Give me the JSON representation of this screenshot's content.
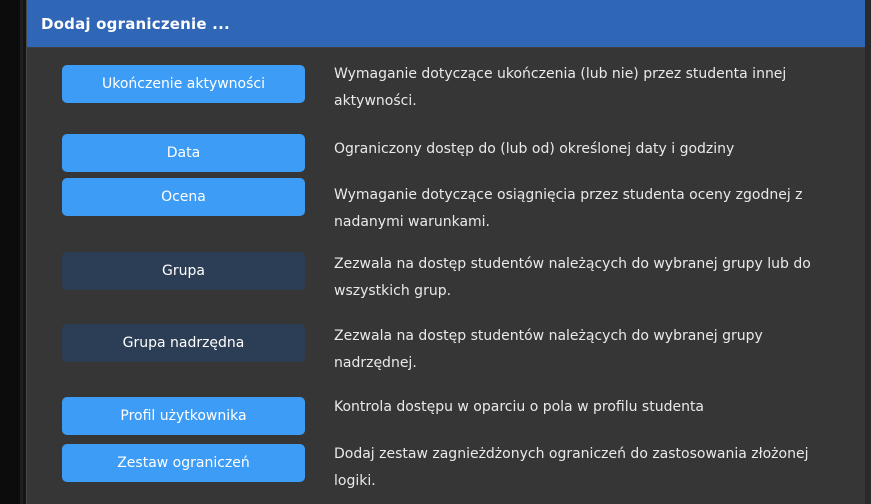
{
  "dialog": {
    "title": "Dodaj ograniczenie ..."
  },
  "options": [
    {
      "label": "Ukończenie aktywności",
      "description": "Wymaganie dotyczące ukończenia (lub nie) przez studenta innej aktywności."
    },
    {
      "label": "Data",
      "description": "Ograniczony dostęp do (lub od) określonej daty i godziny"
    },
    {
      "label": "Ocena",
      "description": "Wymaganie dotyczące osiągnięcia przez studenta oceny zgodnej z nadanymi warunkami."
    },
    {
      "label": "Grupa",
      "description": "Zezwala na dostęp studentów należących do wybranej grupy lub do wszystkich grup."
    },
    {
      "label": "Grupa nadrzędna",
      "description": "Zezwala na dostęp studentów należących do wybranej grupy nadrzędnej."
    },
    {
      "label": "Profil użytkownika",
      "description": "Kontrola dostępu w oparciu o pola w profilu studenta"
    },
    {
      "label": "Zestaw ograniczeń",
      "description": "Dodaj zestaw zagnieżdżonych ograniczeń do zastosowania złożonej logiki."
    }
  ],
  "colors": {
    "header": "#2f66b5",
    "button_primary": "#3d9cf5",
    "button_secondary": "#2c3e55",
    "modal_bg": "#363636"
  }
}
